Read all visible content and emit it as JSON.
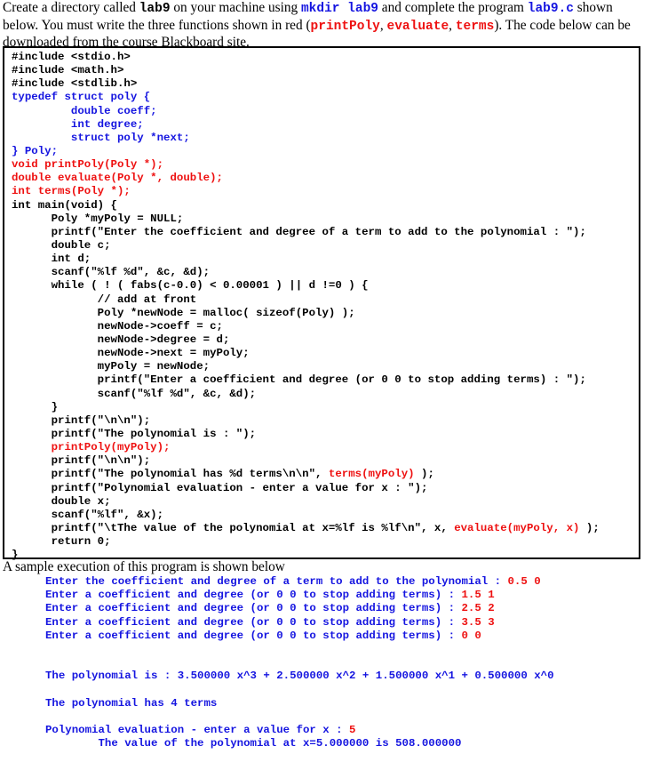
{
  "intro": {
    "part1": "Create a directory called ",
    "dir_name": "lab9",
    "part2": " on your machine using ",
    "mkdir_cmd": "mkdir lab9",
    "part3": " and complete the program ",
    "program_file": "lab9.c",
    "part4": " shown below.  You must write the three functions shown in red (",
    "fn1": "printPoly",
    "sep1": ", ",
    "fn2": "evaluate",
    "sep2": ", ",
    "fn3": "terms",
    "part5": ").  The code below can be downloaded from the course Blackboard site."
  },
  "code": {
    "lines": [
      {
        "segments": [
          {
            "text": "#include <stdio.h>",
            "color": "black"
          }
        ]
      },
      {
        "segments": [
          {
            "text": "#include <math.h>",
            "color": "black"
          }
        ]
      },
      {
        "segments": [
          {
            "text": "#include <stdlib.h>",
            "color": "black"
          }
        ]
      },
      {
        "segments": [
          {
            "text": "typedef struct poly {",
            "color": "blue"
          }
        ]
      },
      {
        "segments": [
          {
            "text": "         double coeff;",
            "color": "blue"
          }
        ]
      },
      {
        "segments": [
          {
            "text": "         int degree;",
            "color": "blue"
          }
        ]
      },
      {
        "segments": [
          {
            "text": "         struct poly *next;",
            "color": "blue"
          }
        ]
      },
      {
        "segments": [
          {
            "text": "} Poly;",
            "color": "blue"
          }
        ]
      },
      {
        "segments": [
          {
            "text": "void printPoly(Poly *);",
            "color": "red"
          }
        ]
      },
      {
        "segments": [
          {
            "text": "double evaluate(Poly *, double);",
            "color": "red"
          }
        ]
      },
      {
        "segments": [
          {
            "text": "int terms(Poly *);",
            "color": "red"
          }
        ]
      },
      {
        "segments": [
          {
            "text": "int main(void) {",
            "color": "black"
          }
        ]
      },
      {
        "segments": [
          {
            "text": "      Poly *myPoly = NULL;",
            "color": "black"
          }
        ]
      },
      {
        "segments": [
          {
            "text": "      printf(\"Enter the coefficient and degree of a term to add to the polynomial : \");",
            "color": "black"
          }
        ]
      },
      {
        "segments": [
          {
            "text": "      double c;",
            "color": "black"
          }
        ]
      },
      {
        "segments": [
          {
            "text": "      int d;",
            "color": "black"
          }
        ]
      },
      {
        "segments": [
          {
            "text": "      scanf(\"%lf %d\", &c, &d);",
            "color": "black"
          }
        ]
      },
      {
        "segments": [
          {
            "text": "      while ( ! ( fabs(c-0.0) < 0.00001 ) || d !=0 ) {",
            "color": "black"
          }
        ]
      },
      {
        "segments": [
          {
            "text": "             // add at front",
            "color": "black"
          }
        ]
      },
      {
        "segments": [
          {
            "text": "             Poly *newNode = malloc( sizeof(Poly) );",
            "color": "black"
          }
        ]
      },
      {
        "segments": [
          {
            "text": "             newNode->coeff = c;",
            "color": "black"
          }
        ]
      },
      {
        "segments": [
          {
            "text": "             newNode->degree = d;",
            "color": "black"
          }
        ]
      },
      {
        "segments": [
          {
            "text": "             newNode->next = myPoly;",
            "color": "black"
          }
        ]
      },
      {
        "segments": [
          {
            "text": "             myPoly = newNode;",
            "color": "black"
          }
        ]
      },
      {
        "segments": [
          {
            "text": "             printf(\"Enter a coefficient and degree (or 0 0 to stop adding terms) : \");",
            "color": "black"
          }
        ]
      },
      {
        "segments": [
          {
            "text": "             scanf(\"%lf %d\", &c, &d);",
            "color": "black"
          }
        ]
      },
      {
        "segments": [
          {
            "text": "      }",
            "color": "black"
          }
        ]
      },
      {
        "segments": [
          {
            "text": "      printf(\"\\n\\n\");",
            "color": "black"
          }
        ]
      },
      {
        "segments": [
          {
            "text": "      printf(\"The polynomial is : \");",
            "color": "black"
          }
        ]
      },
      {
        "segments": [
          {
            "text": "      printPoly(myPoly);",
            "color": "red"
          }
        ]
      },
      {
        "segments": [
          {
            "text": "      printf(\"\\n\\n\");",
            "color": "black"
          }
        ]
      },
      {
        "segments": [
          {
            "text": "      printf(\"The polynomial has %d terms\\n\\n\", ",
            "color": "black"
          },
          {
            "text": "terms(myPoly)",
            "color": "red"
          },
          {
            "text": " );",
            "color": "black"
          }
        ]
      },
      {
        "segments": [
          {
            "text": "      printf(\"Polynomial evaluation - enter a value for x : \");",
            "color": "black"
          }
        ]
      },
      {
        "segments": [
          {
            "text": "      double x;",
            "color": "black"
          }
        ]
      },
      {
        "segments": [
          {
            "text": "      scanf(\"%lf\", &x);",
            "color": "black"
          }
        ]
      },
      {
        "segments": [
          {
            "text": "      printf(\"\\tThe value of the polynomial at x=%lf is %lf\\n\", x, ",
            "color": "black"
          },
          {
            "text": "evaluate(myPoly, x)",
            "color": "red"
          },
          {
            "text": " );",
            "color": "black"
          }
        ]
      },
      {
        "segments": [
          {
            "text": "      return 0;",
            "color": "black"
          }
        ]
      },
      {
        "segments": [
          {
            "text": "}",
            "color": "black"
          }
        ]
      }
    ]
  },
  "sample": {
    "label": "A sample execution of this program is shown below",
    "lines": [
      {
        "prompt": "Enter the coefficient and degree of a term to add to the polynomial : ",
        "input": "0.5 0"
      },
      {
        "prompt": "Enter a coefficient and degree (or 0 0 to stop adding terms) : ",
        "input": "1.5 1"
      },
      {
        "prompt": "Enter a coefficient and degree (or 0 0 to stop adding terms) : ",
        "input": "2.5 2"
      },
      {
        "prompt": "Enter a coefficient and degree (or 0 0 to stop adding terms) : ",
        "input": "3.5 3"
      },
      {
        "prompt": "Enter a coefficient and degree (or 0 0 to stop adding terms) : ",
        "input": "0 0"
      },
      {
        "prompt": "",
        "input": ""
      },
      {
        "prompt": "",
        "input": ""
      },
      {
        "prompt": "The polynomial is : 3.500000 x^3 + 2.500000 x^2 + 1.500000 x^1 + 0.500000 x^0",
        "input": ""
      },
      {
        "prompt": "",
        "input": ""
      },
      {
        "prompt": "The polynomial has 4 terms",
        "input": ""
      },
      {
        "prompt": "",
        "input": ""
      },
      {
        "prompt": "Polynomial evaluation - enter a value for x : ",
        "input": "5"
      },
      {
        "prompt": "        The value of the polynomial at x=5.000000 is 508.000000",
        "input": ""
      }
    ]
  },
  "colors": {
    "blue": "#1515e0",
    "red": "#ee1111",
    "black": "#000000"
  }
}
